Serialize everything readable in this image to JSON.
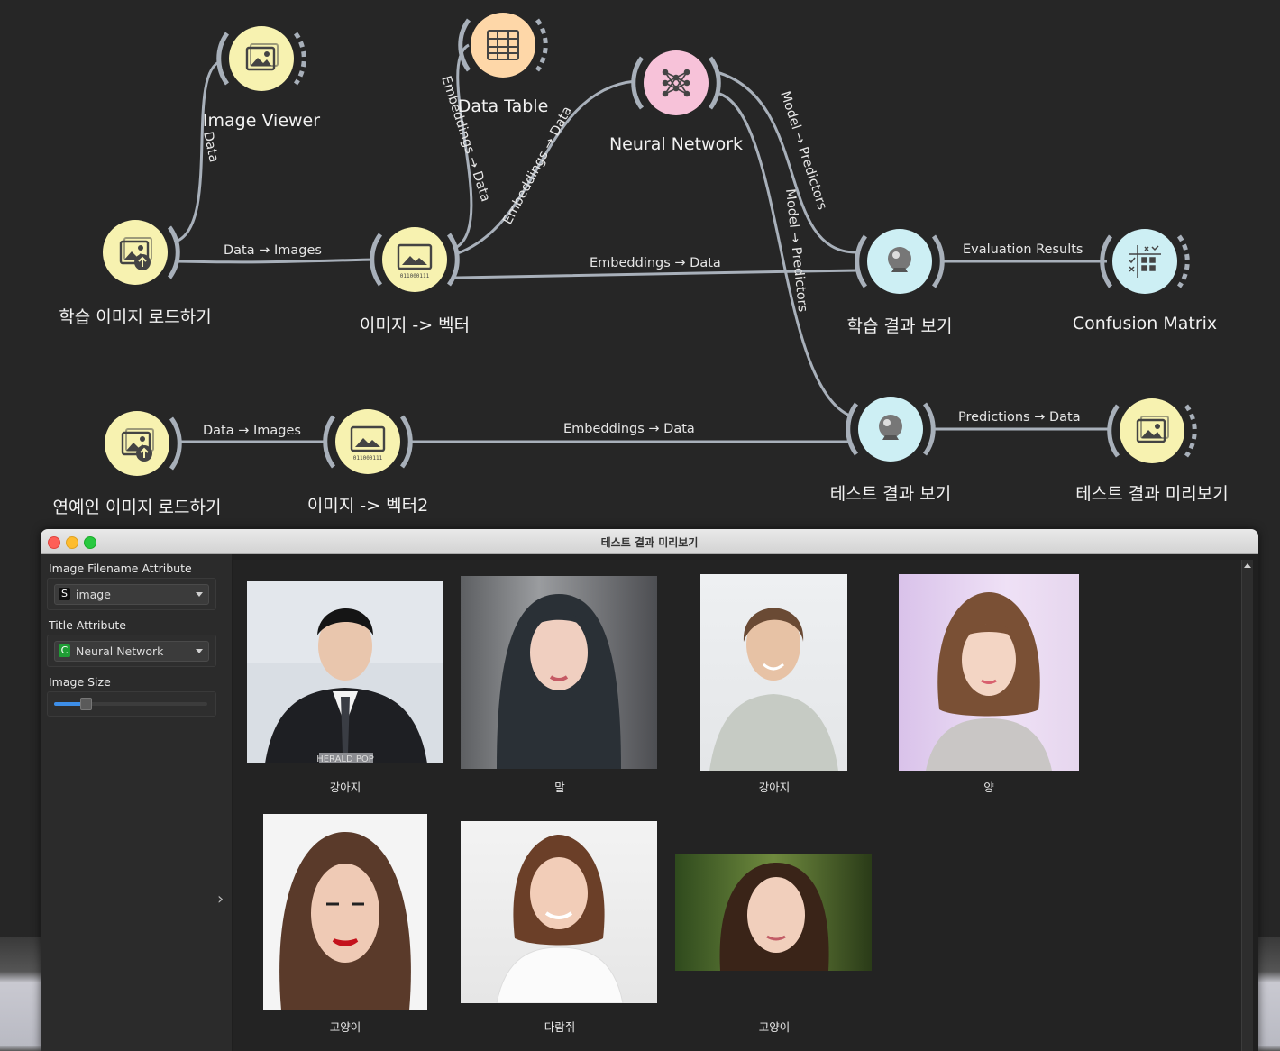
{
  "workflow": {
    "nodes": {
      "image_viewer": "Image Viewer",
      "data_table": "Data Table",
      "neural_network": "Neural Network",
      "train_loader": "학습 이미지 로드하기",
      "embedder1": "이미지 -> 벡터",
      "train_results": "학습 결과 보기",
      "confusion_matrix": "Confusion Matrix",
      "test_loader": "연예인 이미지 로드하기",
      "embedder2": "이미지 -> 벡터2",
      "test_results": "테스트 결과 보기",
      "test_preview": "테스트 결과 미리보기"
    },
    "links": {
      "data": "Data",
      "data_images_1": "Data → Images",
      "embeddings_data_table": "Embeddings → Data",
      "embeddings_data_nn": "Embeddings → Data",
      "embeddings_data_train": "Embeddings → Data",
      "model_predictors_1": "Model → Predictors",
      "model_predictors_2": "Model → Predictors",
      "evaluation_results": "Evaluation Results",
      "data_images_2": "Data → Images",
      "embeddings_data_test": "Embeddings → Data",
      "predictions_data": "Predictions → Data"
    }
  },
  "window": {
    "title": "테스트 결과 미리보기",
    "sidebar": {
      "filename_label": "Image Filename Attribute",
      "filename_tag": "S",
      "filename_value": "image",
      "title_label": "Title Attribute",
      "title_tag": "C",
      "title_value": "Neural Network",
      "size_label": "Image Size",
      "size_fraction": 0.2
    },
    "thumbnails": [
      {
        "caption": "강아지",
        "photo_text": "HERALD POP"
      },
      {
        "caption": "말"
      },
      {
        "caption": "강아지"
      },
      {
        "caption": "양"
      },
      {
        "caption": "고양이"
      },
      {
        "caption": "다람쥐"
      },
      {
        "caption": "고양이"
      }
    ]
  },
  "colors": {
    "loader_node": "#f7f2b0",
    "table_node": "#fed7a8",
    "nn_node": "#f7c2d9",
    "predict_node": "#cdeff4",
    "link": "#a8b0ba"
  }
}
